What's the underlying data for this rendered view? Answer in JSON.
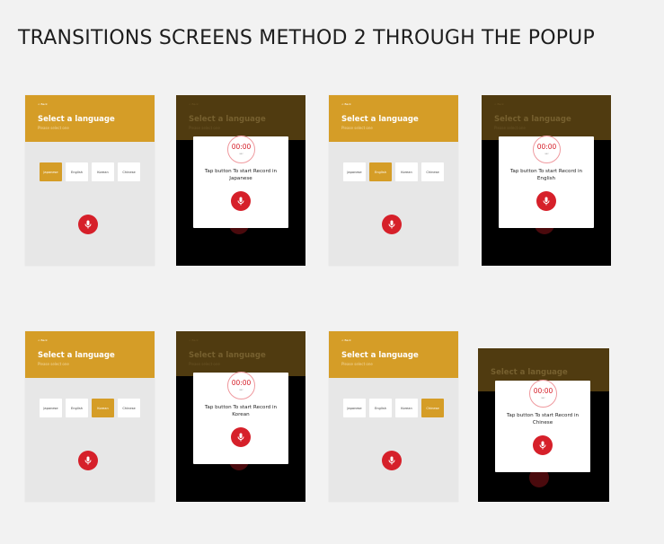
{
  "page": {
    "title": "TRANSITIONS SCREENS METHOD 2 THROUGH THE POPUP"
  },
  "screen": {
    "back_label": "< Back",
    "title": "Select a language",
    "subtitle": "Please select one",
    "languages": [
      "Japanese",
      "English",
      "Korean",
      "Chinese"
    ]
  },
  "popup": {
    "timer": "00:00",
    "timer_unit": "sec",
    "messages": [
      "Tap button To start Record in Japanese",
      "Tap button To start Record in English",
      "Tap button To start Record in Korean",
      "Tap button To start Record in Chinese"
    ]
  },
  "colors": {
    "accent": "#d59d27",
    "record_red": "#d6202a",
    "screen_bg": "#e7e7e7",
    "page_bg": "#f2f2f2"
  }
}
